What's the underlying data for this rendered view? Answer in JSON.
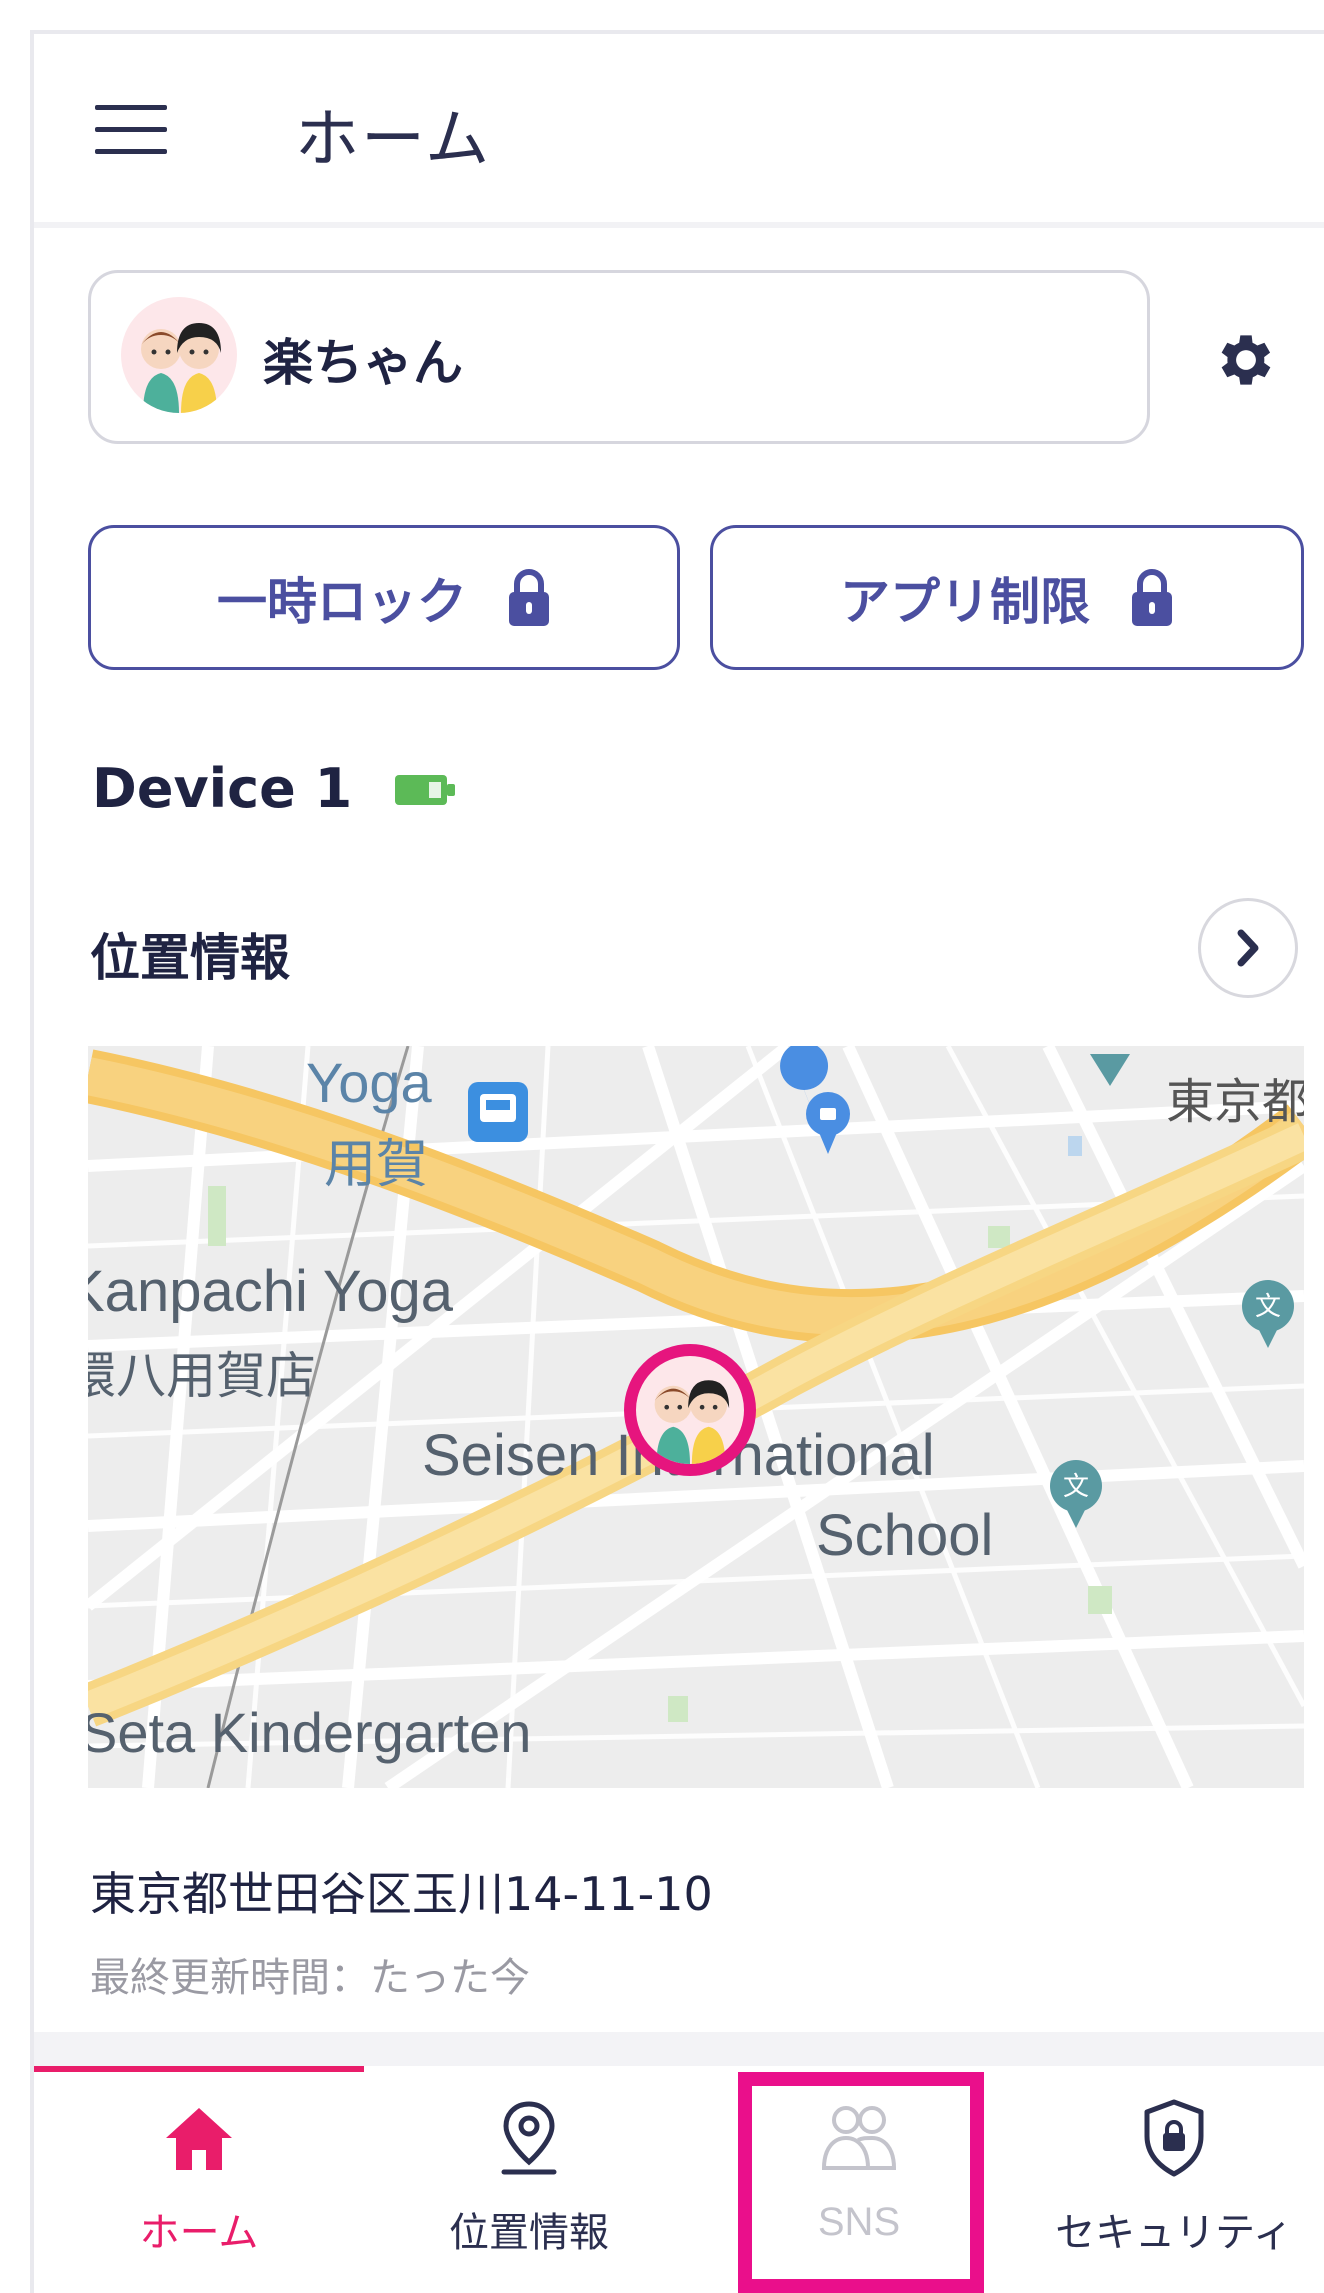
{
  "header": {
    "title": "ホーム"
  },
  "profile": {
    "name": "楽ちゃん"
  },
  "actions": {
    "lock_label": "一時ロック",
    "app_limit_label": "アプリ制限"
  },
  "device": {
    "name": "Device 1",
    "battery_color": "#5cba57"
  },
  "location": {
    "section_title": "位置情報",
    "address": "東京都世田谷区玉川14-11-10",
    "updated": "最終更新時間：たった今",
    "map_labels": {
      "yoga_en": "Yoga",
      "yoga_ja": "用賀",
      "kanpachi_en": "Kanpachi Yoga",
      "kanpachi_ja": "環八用賀店",
      "seisen": "Seisen International",
      "school": "School",
      "kindergarten": "Seta Kindergarten",
      "tokyo": "東京都"
    }
  },
  "nav": {
    "home": "ホーム",
    "location": "位置情報",
    "sns": "SNS",
    "security": "セキュリティ"
  },
  "colors": {
    "accent": "#e91d6a",
    "primary": "#4b4fa0",
    "highlight": "#ea0f8b"
  }
}
